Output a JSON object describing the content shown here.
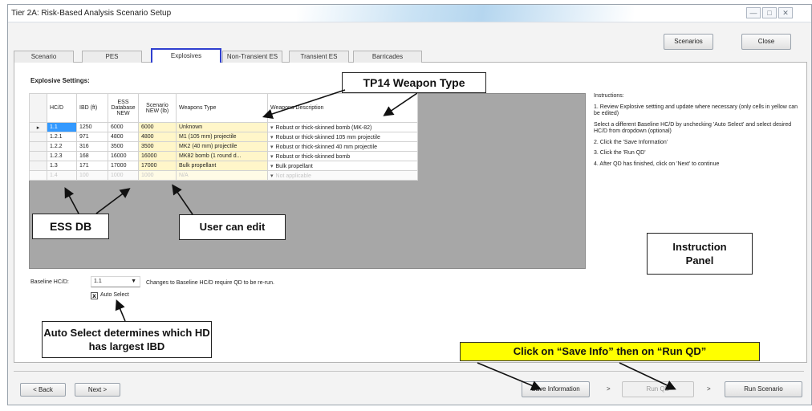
{
  "window": {
    "title": "Tier 2A: Risk-Based Analysis Scenario Setup",
    "controls": [
      "—",
      "□",
      "✕"
    ]
  },
  "header_buttons": {
    "scenarios": "Scenarios",
    "close": "Close"
  },
  "tabs": [
    {
      "label": "Scenario",
      "active": false
    },
    {
      "label": "PES",
      "active": false
    },
    {
      "label": "Explosives",
      "active": true
    },
    {
      "label": "Non-Transient ES",
      "active": false
    },
    {
      "label": "Transient ES",
      "active": false
    },
    {
      "label": "Barricades",
      "active": false
    }
  ],
  "section_title": "Explosive Settings:",
  "grid": {
    "columns": [
      "HC/D",
      "IBD (ft)",
      "ESS Database NEW",
      "Scenario NEW (lb)",
      "Weapons Type",
      "Weapons Description"
    ],
    "rows": [
      {
        "hcd": "1.1",
        "ibd": "1250",
        "ess": "6000",
        "scenario": "6000",
        "type": "Unknown",
        "desc": "Robust or thick-skinned bomb (MK-82)"
      },
      {
        "hcd": "1.2.1",
        "ibd": "971",
        "ess": "4800",
        "scenario": "4800",
        "type": "M1 (105 mm) projectile",
        "desc": "Robust or thick-skinned 105 mm projectile"
      },
      {
        "hcd": "1.2.2",
        "ibd": "316",
        "ess": "3500",
        "scenario": "3500",
        "type": "MK2 (40 mm) projectile",
        "desc": "Robust or thick-skinned 40 mm projectile"
      },
      {
        "hcd": "1.2.3",
        "ibd": "168",
        "ess": "16000",
        "scenario": "16000",
        "type": "MK82 bomb (1 round d...",
        "desc": "Robust or thick-skinned bomb"
      },
      {
        "hcd": "1.3",
        "ibd": "171",
        "ess": "17000",
        "scenario": "17000",
        "type": "Bulk propellant",
        "desc": "Bulk propellant"
      },
      {
        "hcd": "1.4",
        "ibd": "100",
        "ess": "1000",
        "scenario": "1000",
        "type": "N/A",
        "desc": "Not applicable"
      }
    ],
    "row_indicator": "▸"
  },
  "annotations": {
    "weapon_type": "TP14 Weapon Type",
    "ess_db": "ESS DB",
    "user_edit": "User can edit",
    "instruction_panel": "Instruction Panel",
    "auto_select": "Auto Select determines which HD has largest IBD",
    "save_run": "Click on “Save Info” then on “Run QD”"
  },
  "instructions": {
    "heading": "Instructions:",
    "items": [
      "1. Review Explosive settting and update where necessary (only cells in yellow can be edited)",
      "Select a different Baseline HC/D by unchecking 'Auto Select' and select desired HC/D from dropdown (optional)",
      "2. Click the 'Save Information'",
      "3. Click the 'Run QD'",
      "4. After QD has finished, click on 'Next' to continue"
    ]
  },
  "baseline": {
    "label": "Baseline HC/D:",
    "value": "1.1",
    "note": "Changes to Baseline HC/D require QD to be re-run.",
    "auto_select_label": "Auto Select",
    "auto_select_checked": true,
    "check_mark": "x"
  },
  "footer": {
    "back": "< Back",
    "next": "Next >",
    "save": "Save Information",
    "run_qd": "Run QD",
    "run_scenario": "Run Scenario",
    "sep": ">"
  }
}
